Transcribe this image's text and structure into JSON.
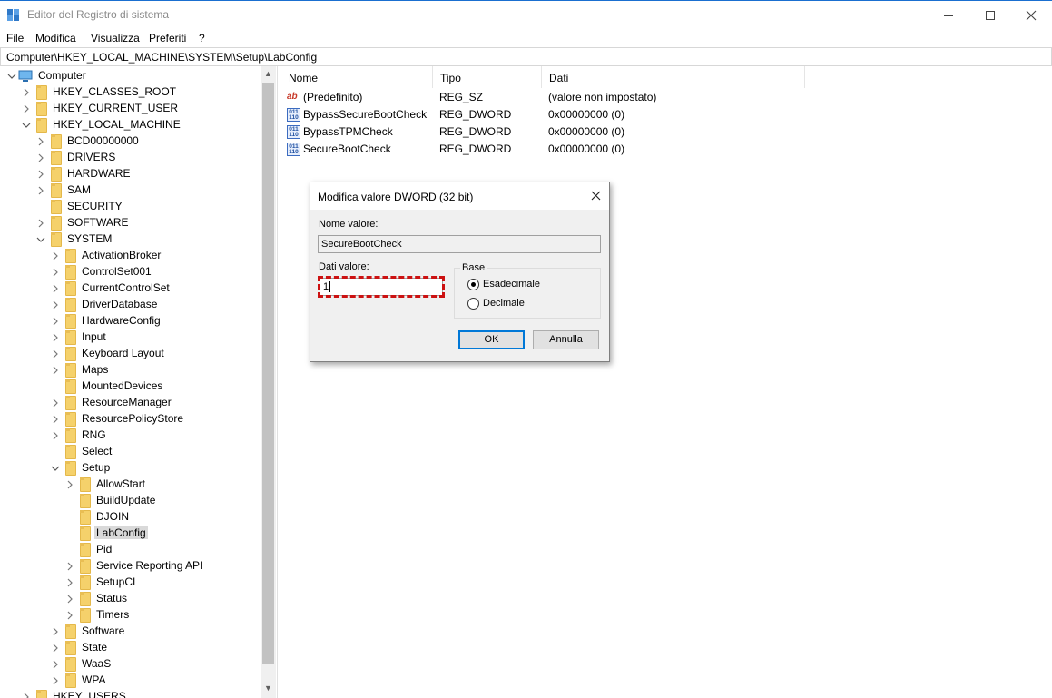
{
  "window": {
    "title": "Editor del Registro di sistema",
    "accent_color": "#1a6fd0"
  },
  "menu": [
    "File",
    "Modifica",
    "Visualizza",
    "Preferiti",
    "?"
  ],
  "address": "Computer\\HKEY_LOCAL_MACHINE\\SYSTEM\\Setup\\LabConfig",
  "tree": {
    "root": "Computer",
    "items": [
      {
        "label": "HKEY_CLASSES_ROOT",
        "level": 1,
        "state": "collapsed"
      },
      {
        "label": "HKEY_CURRENT_USER",
        "level": 1,
        "state": "collapsed"
      },
      {
        "label": "HKEY_LOCAL_MACHINE",
        "level": 1,
        "state": "expanded"
      },
      {
        "label": "BCD00000000",
        "level": 2,
        "state": "collapsed"
      },
      {
        "label": "DRIVERS",
        "level": 2,
        "state": "collapsed"
      },
      {
        "label": "HARDWARE",
        "level": 2,
        "state": "collapsed"
      },
      {
        "label": "SAM",
        "level": 2,
        "state": "collapsed"
      },
      {
        "label": "SECURITY",
        "level": 2,
        "state": "leaf"
      },
      {
        "label": "SOFTWARE",
        "level": 2,
        "state": "collapsed"
      },
      {
        "label": "SYSTEM",
        "level": 2,
        "state": "expanded"
      },
      {
        "label": "ActivationBroker",
        "level": 3,
        "state": "collapsed"
      },
      {
        "label": "ControlSet001",
        "level": 3,
        "state": "collapsed"
      },
      {
        "label": "CurrentControlSet",
        "level": 3,
        "state": "collapsed"
      },
      {
        "label": "DriverDatabase",
        "level": 3,
        "state": "collapsed"
      },
      {
        "label": "HardwareConfig",
        "level": 3,
        "state": "collapsed"
      },
      {
        "label": "Input",
        "level": 3,
        "state": "collapsed"
      },
      {
        "label": "Keyboard Layout",
        "level": 3,
        "state": "collapsed"
      },
      {
        "label": "Maps",
        "level": 3,
        "state": "collapsed"
      },
      {
        "label": "MountedDevices",
        "level": 3,
        "state": "leaf"
      },
      {
        "label": "ResourceManager",
        "level": 3,
        "state": "collapsed"
      },
      {
        "label": "ResourcePolicyStore",
        "level": 3,
        "state": "collapsed"
      },
      {
        "label": "RNG",
        "level": 3,
        "state": "collapsed"
      },
      {
        "label": "Select",
        "level": 3,
        "state": "leaf"
      },
      {
        "label": "Setup",
        "level": 3,
        "state": "expanded"
      },
      {
        "label": "AllowStart",
        "level": 4,
        "state": "collapsed"
      },
      {
        "label": "BuildUpdate",
        "level": 4,
        "state": "leaf"
      },
      {
        "label": "DJOIN",
        "level": 4,
        "state": "leaf"
      },
      {
        "label": "LabConfig",
        "level": 4,
        "state": "leaf",
        "selected": true
      },
      {
        "label": "Pid",
        "level": 4,
        "state": "leaf"
      },
      {
        "label": "Service Reporting API",
        "level": 4,
        "state": "collapsed"
      },
      {
        "label": "SetupCI",
        "level": 4,
        "state": "collapsed"
      },
      {
        "label": "Status",
        "level": 4,
        "state": "collapsed"
      },
      {
        "label": "Timers",
        "level": 4,
        "state": "collapsed"
      },
      {
        "label": "Software",
        "level": 3,
        "state": "collapsed"
      },
      {
        "label": "State",
        "level": 3,
        "state": "collapsed"
      },
      {
        "label": "WaaS",
        "level": 3,
        "state": "collapsed"
      },
      {
        "label": "WPA",
        "level": 3,
        "state": "collapsed"
      },
      {
        "label": "HKEY_USERS",
        "level": 1,
        "state": "collapsed"
      }
    ]
  },
  "list": {
    "columns": [
      "Nome",
      "Tipo",
      "Dati"
    ],
    "rows": [
      {
        "icon": "string-value-icon",
        "name": "(Predefinito)",
        "type": "REG_SZ",
        "data": "(valore non impostato)"
      },
      {
        "icon": "dword-value-icon",
        "name": "BypassSecureBootCheck",
        "type": "REG_DWORD",
        "data": "0x00000000 (0)"
      },
      {
        "icon": "dword-value-icon",
        "name": "BypassTPMCheck",
        "type": "REG_DWORD",
        "data": "0x00000000 (0)"
      },
      {
        "icon": "dword-value-icon",
        "name": "SecureBootCheck",
        "type": "REG_DWORD",
        "data": "0x00000000 (0)"
      }
    ]
  },
  "dialog": {
    "title": "Modifica valore DWORD (32 bit)",
    "name_label": "Nome valore:",
    "name_value": "SecureBootCheck",
    "data_label": "Dati valore:",
    "data_value": "1",
    "base_label": "Base",
    "radio_hex": "Esadecimale",
    "radio_dec": "Decimale",
    "selected_base": "Esadecimale",
    "ok_label": "OK",
    "cancel_label": "Annulla",
    "highlight_color": "#cc1111"
  }
}
